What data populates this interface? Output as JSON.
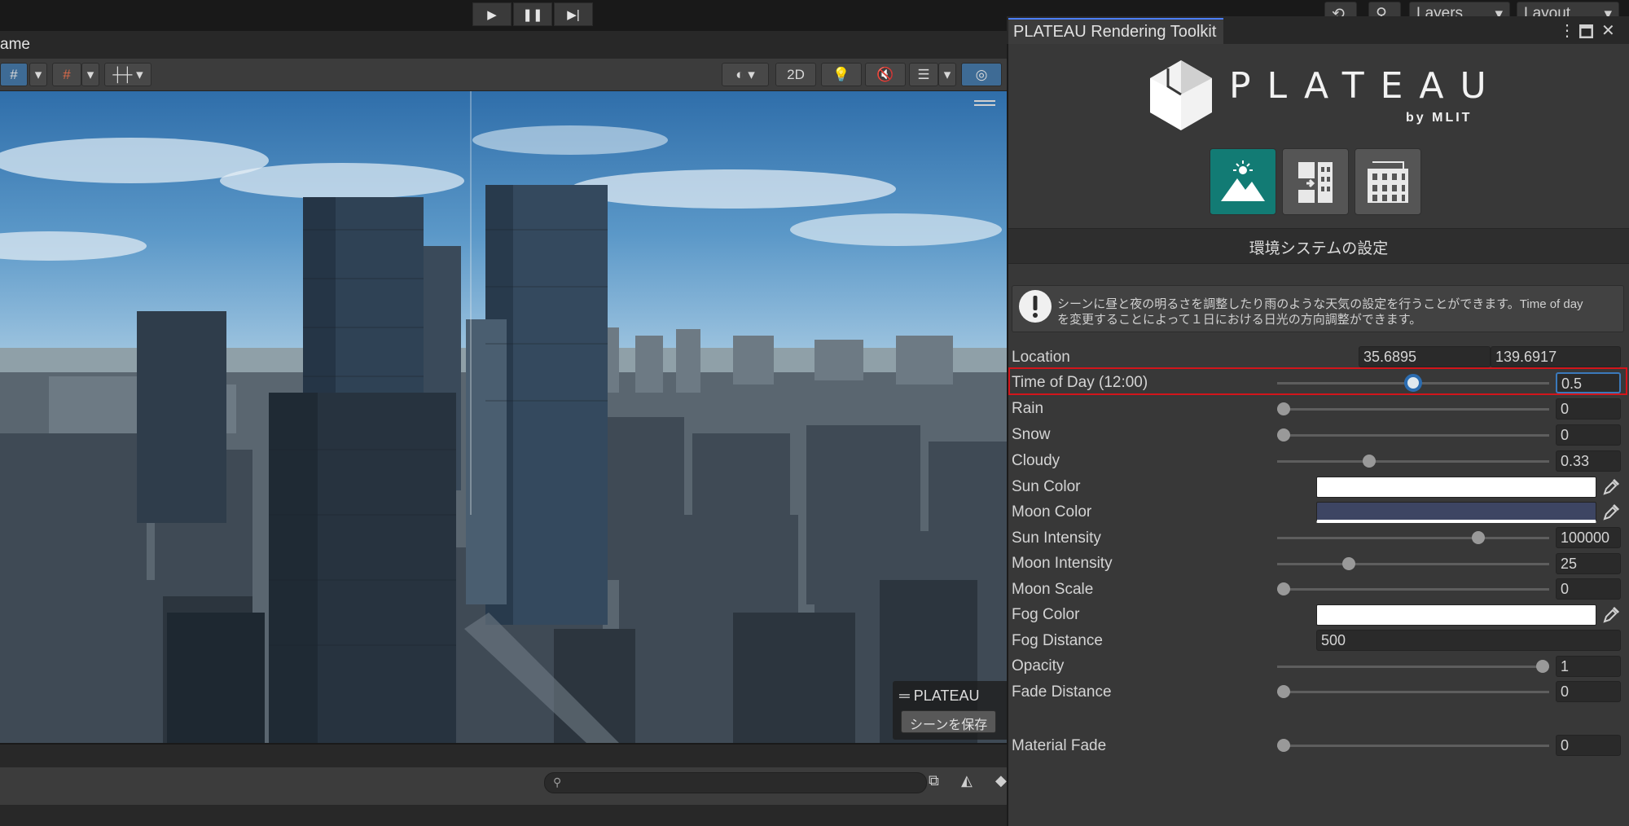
{
  "topbar": {
    "play_icon": "play-icon",
    "pause_icon": "pause-icon",
    "step_icon": "step-icon",
    "layers_label": "Layers",
    "layout_label": "Layout"
  },
  "scene": {
    "tab_label": "ame",
    "toolbar": {
      "mode_2d": "2D"
    },
    "overlay": {
      "title": "PLATEAU",
      "save_button": "シーンを保存"
    }
  },
  "panel": {
    "title": "PLATEAU Rendering Toolkit",
    "logo": {
      "wordmark": "PLATEAU",
      "tagline": "by MLIT"
    },
    "categories": [
      {
        "name": "environment",
        "icon": "sun-mountain-icon",
        "selected": true
      },
      {
        "name": "texture",
        "icon": "building-texture-icon",
        "selected": false
      },
      {
        "name": "buildings",
        "icon": "buildings-icon",
        "selected": false
      }
    ],
    "section_title": "環境システムの設定",
    "help": {
      "line1": "シーンに昼と夜の明るさを調整したり雨のような天気の設定を行うことができます。Time of day",
      "line2": "を変更することによって１日における日光の方向調整ができます。"
    },
    "fields": {
      "location": {
        "label": "Location",
        "lat": "35.6895",
        "lon": "139.6917"
      },
      "time_of_day": {
        "label": "Time of Day (12:00)",
        "value": "0.5",
        "fraction": 0.5
      },
      "rain": {
        "label": "Rain",
        "value": "0",
        "fraction": 0
      },
      "snow": {
        "label": "Snow",
        "value": "0",
        "fraction": 0
      },
      "cloudy": {
        "label": "Cloudy",
        "value": "0.33",
        "fraction": 0.33
      },
      "sun_color": {
        "label": "Sun Color",
        "color": "#ffffff"
      },
      "moon_color": {
        "label": "Moon Color",
        "color": "#3d4563"
      },
      "sun_intensity": {
        "label": "Sun Intensity",
        "value": "100000",
        "fraction": 0.75
      },
      "moon_intensity": {
        "label": "Moon Intensity",
        "value": "25",
        "fraction": 0.25
      },
      "moon_scale": {
        "label": "Moon Scale",
        "value": "0",
        "fraction": 0
      },
      "fog_color": {
        "label": "Fog Color",
        "color": "#ffffff"
      },
      "fog_distance": {
        "label": "Fog Distance",
        "value": "500"
      },
      "opacity": {
        "label": "Opacity",
        "value": "1",
        "fraction": 1
      },
      "fade_distance": {
        "label": "Fade Distance",
        "value": "0",
        "fraction": 0
      },
      "material_fade": {
        "label": "Material Fade",
        "value": "0",
        "fraction": 0
      }
    }
  },
  "colors": {
    "accent": "#4c7fff",
    "selected_category": "#127b74",
    "highlight": "#d2151b"
  }
}
